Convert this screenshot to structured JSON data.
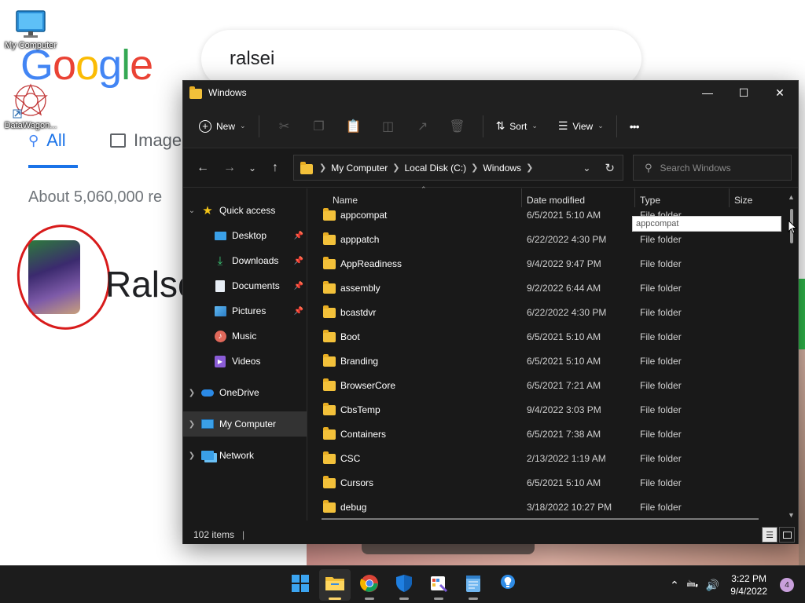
{
  "background": {
    "google_logo": [
      "G",
      "o",
      "o",
      "g",
      "l",
      "e"
    ],
    "search_query": "ralsei",
    "tab_all": "All",
    "tab_images": "Image",
    "about_text": "About 5,060,000 re",
    "result_name": "Ralse"
  },
  "desktop_icons": [
    {
      "label": "My Computer",
      "icon": "monitor-icon"
    },
    {
      "label": "DataWagon...",
      "icon": "datawagon-icon"
    }
  ],
  "window": {
    "title": "Windows",
    "controls": {
      "minimize": "—",
      "maximize": "☐",
      "close": "✕"
    },
    "toolbar": {
      "new_label": "New",
      "sort_label": "Sort",
      "view_label": "View",
      "more_label": "•••"
    },
    "address": {
      "crumbs": [
        "My Computer",
        "Local Disk (C:)",
        "Windows"
      ]
    },
    "search_placeholder": "Search Windows",
    "nav_pane": {
      "quick_access": "Quick access",
      "pinned": [
        {
          "label": "Desktop",
          "icon": "desktop-icon",
          "pinned": true
        },
        {
          "label": "Downloads",
          "icon": "downloads-icon",
          "pinned": true
        },
        {
          "label": "Documents",
          "icon": "documents-icon",
          "pinned": true
        },
        {
          "label": "Pictures",
          "icon": "pictures-icon",
          "pinned": true
        },
        {
          "label": "Music",
          "icon": "music-icon",
          "pinned": false
        },
        {
          "label": "Videos",
          "icon": "videos-icon",
          "pinned": false
        }
      ],
      "onedrive": "OneDrive",
      "my_computer": "My Computer",
      "network": "Network"
    },
    "columns": {
      "name": "Name",
      "date": "Date modified",
      "type": "Type",
      "size": "Size"
    },
    "files": [
      {
        "name": "appcompat",
        "date": "6/5/2021 5:10 AM",
        "type": "File folder"
      },
      {
        "name": "apppatch",
        "date": "6/22/2022 4:30 PM",
        "type": "File folder"
      },
      {
        "name": "AppReadiness",
        "date": "9/4/2022 9:47 PM",
        "type": "File folder"
      },
      {
        "name": "assembly",
        "date": "9/2/2022 6:44 AM",
        "type": "File folder"
      },
      {
        "name": "bcastdvr",
        "date": "6/22/2022 4:30 PM",
        "type": "File folder"
      },
      {
        "name": "Boot",
        "date": "6/5/2021 5:10 AM",
        "type": "File folder"
      },
      {
        "name": "Branding",
        "date": "6/5/2021 5:10 AM",
        "type": "File folder"
      },
      {
        "name": "BrowserCore",
        "date": "6/5/2021 7:21 AM",
        "type": "File folder"
      },
      {
        "name": "CbsTemp",
        "date": "9/4/2022 3:03 PM",
        "type": "File folder"
      },
      {
        "name": "Containers",
        "date": "6/5/2021 7:38 AM",
        "type": "File folder"
      },
      {
        "name": "CSC",
        "date": "2/13/2022 1:19 AM",
        "type": "File folder"
      },
      {
        "name": "Cursors",
        "date": "6/5/2021 5:10 AM",
        "type": "File folder"
      },
      {
        "name": "debug",
        "date": "3/18/2022 10:27 PM",
        "type": "File folder"
      }
    ],
    "tooltip": "appcompat",
    "status_items": "102 items"
  },
  "taskbar": {
    "apps": [
      "windows-start-icon",
      "file-explorer-icon",
      "chrome-icon",
      "defender-icon",
      "paint-icon",
      "notepad-icon",
      "tips-icon"
    ],
    "time": "3:22 PM",
    "date": "9/4/2022",
    "notification_count": "4"
  }
}
